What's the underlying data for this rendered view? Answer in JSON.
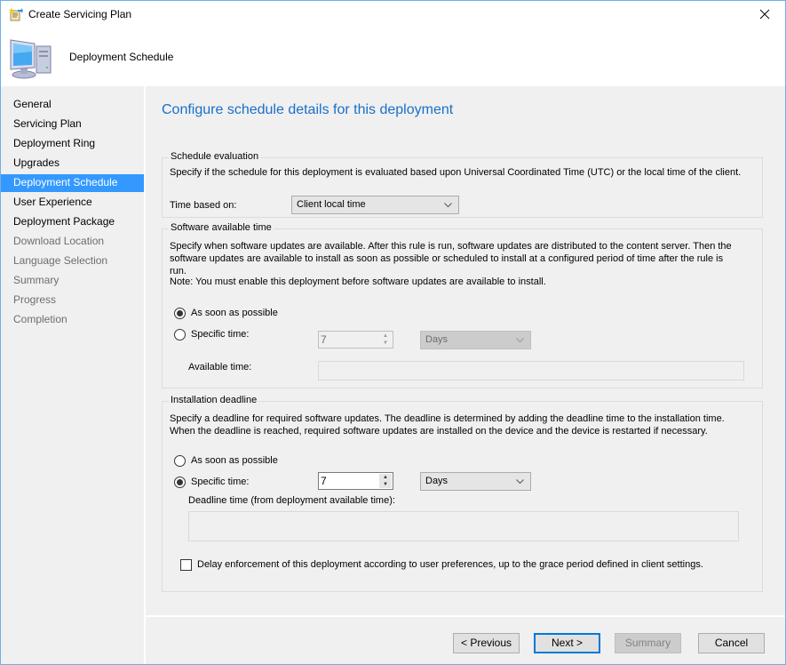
{
  "window": {
    "title": "Create Servicing Plan",
    "close_icon": "close-icon",
    "title_icon": "wizard-icon"
  },
  "header": {
    "title": "Deployment Schedule",
    "icon": "computer-icon"
  },
  "sidebar": {
    "items": [
      {
        "label": "General",
        "state": "enabled"
      },
      {
        "label": "Servicing Plan",
        "state": "enabled"
      },
      {
        "label": "Deployment Ring",
        "state": "enabled"
      },
      {
        "label": "Upgrades",
        "state": "enabled"
      },
      {
        "label": "Deployment Schedule",
        "state": "active"
      },
      {
        "label": "User Experience",
        "state": "enabled"
      },
      {
        "label": "Deployment Package",
        "state": "enabled"
      },
      {
        "label": "Download Location",
        "state": "disabled"
      },
      {
        "label": "Language Selection",
        "state": "disabled"
      },
      {
        "label": "Summary",
        "state": "disabled"
      },
      {
        "label": "Progress",
        "state": "disabled"
      },
      {
        "label": "Completion",
        "state": "disabled"
      }
    ]
  },
  "main": {
    "page_title": "Configure schedule details for this deployment",
    "schedule_evaluation": {
      "legend": "Schedule evaluation",
      "description": "Specify if the schedule for this deployment is evaluated based upon Universal Coordinated Time (UTC) or the local time of the client.",
      "time_based_on_label": "Time based on:",
      "time_based_on_value": "Client local time"
    },
    "software_available_time": {
      "legend": "Software available time",
      "description": "Specify when software updates are available. After this rule is run, software updates are distributed to the content server. Then the software updates are available to install as soon as possible or scheduled to install at a configured period of time after the rule is run.",
      "note": "Note: You must enable this deployment before software updates are available to install.",
      "asap_label": "As soon as possible",
      "asap_checked": true,
      "specific_label": "Specific time:",
      "specific_checked": false,
      "spin_value": "7",
      "unit_value": "Days",
      "available_time_label": "Available time:",
      "available_time_value": ""
    },
    "installation_deadline": {
      "legend": "Installation deadline",
      "description": "Specify a deadline for required software updates. The deadline is determined by adding the deadline time to the installation time. When the deadline is reached, required software updates are installed on the device and the device is restarted if necessary.",
      "asap_label": "As soon as possible",
      "asap_checked": false,
      "specific_label": "Specific time:",
      "specific_checked": true,
      "spin_value": "7",
      "unit_value": "Days",
      "deadline_time_label": "Deadline time (from deployment available time):",
      "deadline_time_value": "",
      "delay_enforcement_label": "Delay enforcement of this deployment according to user preferences, up to the grace period defined in client settings.",
      "delay_enforcement_checked": false
    }
  },
  "footer": {
    "previous_label": "< Previous",
    "next_label": "Next >",
    "summary_label": "Summary",
    "cancel_label": "Cancel"
  },
  "colors": {
    "accent": "#3399ff",
    "title_blue": "#1a6fc9",
    "window_border": "#6fb0e6",
    "default_button_border": "#0078d7"
  }
}
